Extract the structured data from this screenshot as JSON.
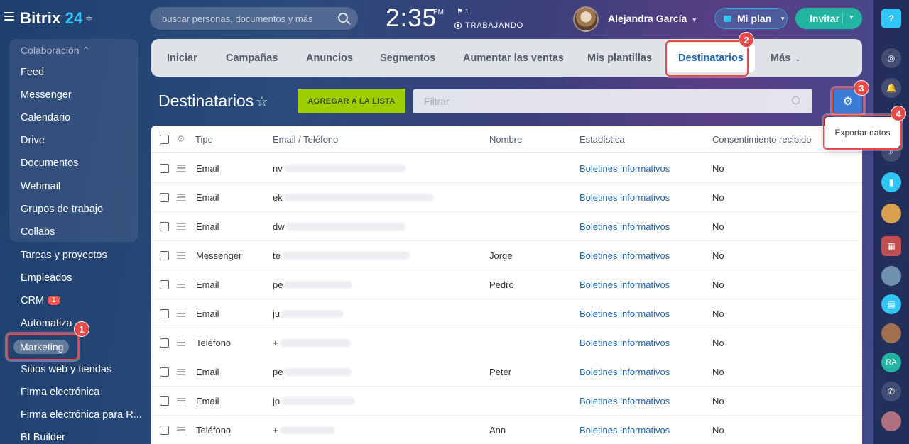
{
  "app": {
    "logo_text": "Bitrix",
    "logo_num": "24",
    "search_placeholder": "buscar personas, documentos y más",
    "clock": "2:35",
    "ampm": "PM",
    "flag_count": "1",
    "work_status": "TRABAJANDO",
    "user_name": "Alejandra García",
    "plan_label": "Mi plan",
    "invite_label": "Invitar"
  },
  "sidebar": {
    "group_title": "Colaboración",
    "group_items": [
      "Feed",
      "Messenger",
      "Calendario",
      "Drive",
      "Documentos",
      "Webmail",
      "Grupos de trabajo",
      "Collabs"
    ],
    "items": [
      "Tareas y proyectos",
      "Empleados",
      "CRM",
      "Automatiza",
      "Marketing",
      "Sitios web y tiendas",
      "Firma electrónica",
      "Firma electrónica para R...",
      "BI Builder"
    ],
    "crm_badge": "1"
  },
  "tabs": [
    "Iniciar",
    "Campañas",
    "Anuncios",
    "Segmentos",
    "Aumentar las ventas",
    "Mis plantillas",
    "Destinatarios",
    "Más"
  ],
  "page": {
    "title": "Destinatarios",
    "add_button": "AGREGAR A LA LISTA",
    "filter_placeholder": "Filtrar",
    "export_label": "Exportar datos"
  },
  "annotations": [
    "1",
    "2",
    "3",
    "4"
  ],
  "table": {
    "columns": [
      "Tipo",
      "Email / Teléfono",
      "Nombre",
      "Estadística",
      "Consentimiento recibido"
    ],
    "rows": [
      {
        "tipo": "Email",
        "contact": "nv",
        "nombre": "",
        "stat": "Boletines informativos",
        "consent": "No"
      },
      {
        "tipo": "Email",
        "contact": "ek",
        "nombre": "",
        "stat": "Boletines informativos",
        "consent": "No"
      },
      {
        "tipo": "Email",
        "contact": "dw",
        "nombre": "",
        "stat": "Boletines informativos",
        "consent": "No"
      },
      {
        "tipo": "Messenger",
        "contact": "te",
        "nombre": "Jorge",
        "stat": "Boletines informativos",
        "consent": "No"
      },
      {
        "tipo": "Email",
        "contact": "pe",
        "nombre": "Pedro",
        "stat": "Boletines informativos",
        "consent": "No"
      },
      {
        "tipo": "Email",
        "contact": "ju",
        "nombre": "",
        "stat": "Boletines informativos",
        "consent": "No"
      },
      {
        "tipo": "Teléfono",
        "contact": "+",
        "nombre": "",
        "stat": "Boletines informativos",
        "consent": "No"
      },
      {
        "tipo": "Email",
        "contact": "pe",
        "nombre": "Peter",
        "stat": "Boletines informativos",
        "consent": "No"
      },
      {
        "tipo": "Email",
        "contact": "jo",
        "nombre": "",
        "stat": "Boletines informativos",
        "consent": "No"
      },
      {
        "tipo": "Teléfono",
        "contact": "+",
        "nombre": "Ann",
        "stat": "Boletines informativos",
        "consent": "No"
      }
    ]
  },
  "colors": {
    "accent_blue": "#2066b0",
    "add_green": "#9dcf00",
    "highlight_red": "#e84a4a",
    "invite_teal": "#21b4a0"
  }
}
